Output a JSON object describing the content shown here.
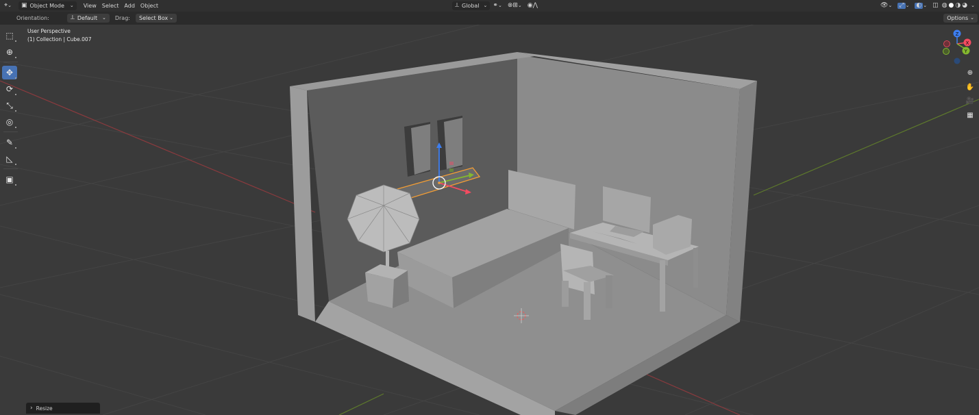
{
  "header": {
    "editor_type_icon": "3d-viewport-icon",
    "mode": "Object Mode",
    "menus": [
      "View",
      "Select",
      "Add",
      "Object"
    ],
    "transform_orientation": "Global",
    "pivot_icon": "pivot-icon",
    "snap_icon": "magnet-icon",
    "proportional_icon": "proportional-edit-icon"
  },
  "tool_settings": {
    "orientation_label": "Orientation:",
    "orientation_value": "Default",
    "drag_label": "Drag:",
    "drag_value": "Select Box",
    "options_label": "Options"
  },
  "overlay": {
    "view_name": "User Perspective",
    "collection_info": "(1) Collection | Cube.007"
  },
  "toolbar": {
    "tools": [
      {
        "name": "select-box",
        "glyph": "⬚"
      },
      {
        "name": "cursor",
        "glyph": "⊕"
      },
      {
        "name": "move",
        "glyph": "✥",
        "active": true
      },
      {
        "name": "rotate",
        "glyph": "⟳"
      },
      {
        "name": "scale",
        "glyph": "⤡"
      },
      {
        "name": "transform",
        "glyph": "◎"
      },
      {
        "name": "annotate",
        "glyph": "✎"
      },
      {
        "name": "measure",
        "glyph": "📐"
      },
      {
        "name": "add-cube",
        "glyph": "▣"
      }
    ]
  },
  "gizmo": {
    "x": "X",
    "y": "Y",
    "z": "Z"
  },
  "last_operation": "Resize",
  "colors": {
    "viewport_bg": "#3a3a3a",
    "header_bg": "#303030",
    "active_tool": "#4772b3",
    "x_axis": "#f44b60",
    "y_axis": "#84b82e",
    "z_axis": "#3d7ef0",
    "selection": "#f29d35",
    "model_grey": "#8d8d8d"
  }
}
